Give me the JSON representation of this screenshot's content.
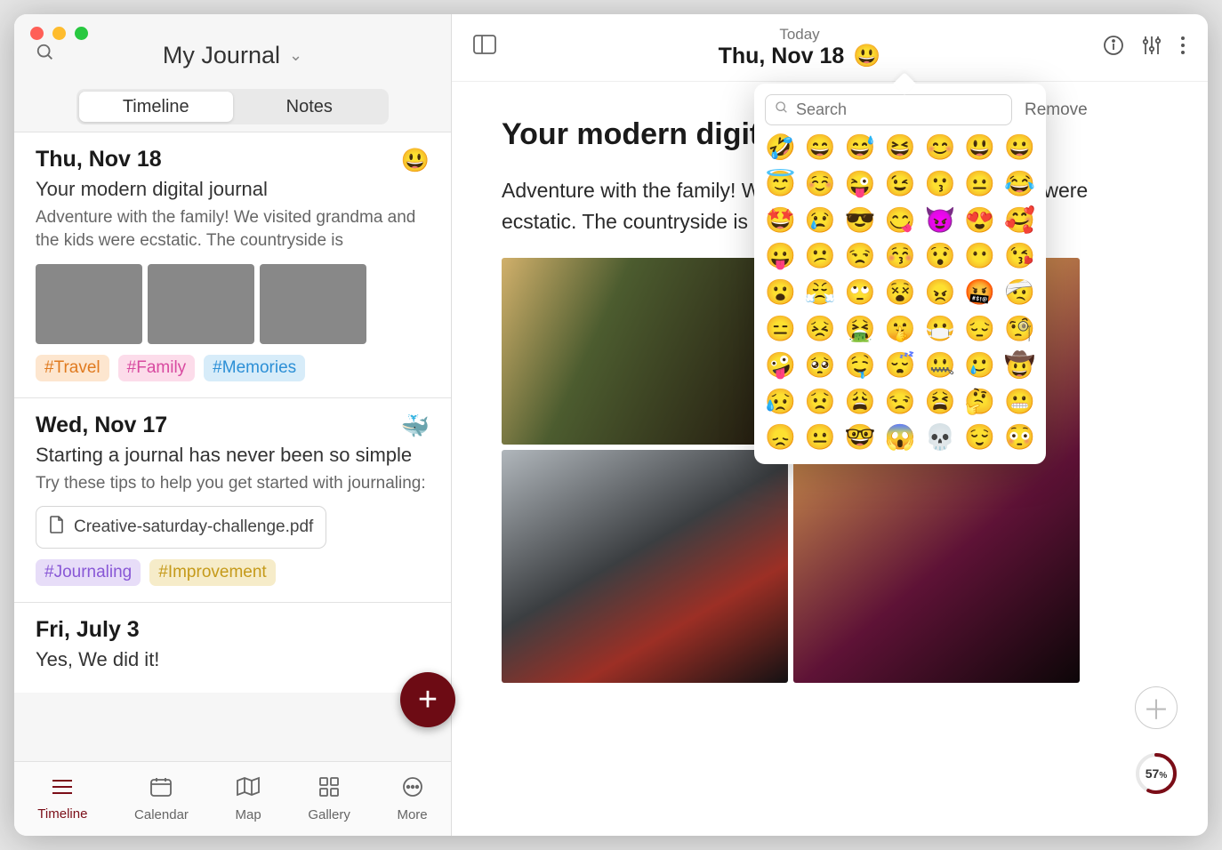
{
  "window": {
    "journal_name": "My Journal"
  },
  "traffic_light_colors": {
    "close": "#ff5f57",
    "minimize": "#febc2e",
    "zoom": "#28c840"
  },
  "segmented": {
    "timeline": "Timeline",
    "notes": "Notes",
    "active": "timeline"
  },
  "bottom_tabs": {
    "items": [
      {
        "icon": "timeline-icon",
        "label": "Timeline",
        "active": true
      },
      {
        "icon": "calendar-icon",
        "label": "Calendar",
        "active": false
      },
      {
        "icon": "map-icon",
        "label": "Map",
        "active": false
      },
      {
        "icon": "gallery-icon",
        "label": "Gallery",
        "active": false
      },
      {
        "icon": "more-icon",
        "label": "More",
        "active": false
      }
    ]
  },
  "entries": [
    {
      "date": "Thu, Nov 18",
      "emoji": "😃",
      "title": "Your modern digital journal",
      "body": "Adventure with the family! We visited grandma and the kids were ecstatic. The countryside is",
      "thumbs": 3,
      "tags": [
        {
          "text": "#Travel",
          "fg": "#e07a1f",
          "bg": "#fde6cf"
        },
        {
          "text": "#Family",
          "fg": "#d84aa0",
          "bg": "#fcdcea"
        },
        {
          "text": "#Memories",
          "fg": "#2c8fd6",
          "bg": "#d7ecf9"
        }
      ]
    },
    {
      "date": "Wed, Nov 17",
      "emoji": "🐳",
      "title": "Starting a journal has never been so simple",
      "body": "Try these tips to help you get started with journaling:",
      "attachment": "Creative-saturday-challenge.pdf",
      "tags": [
        {
          "text": "#Journaling",
          "fg": "#8857d6",
          "bg": "#e7ddf8"
        },
        {
          "text": "#Improvement",
          "fg": "#c59a1a",
          "bg": "#f6ecc9"
        }
      ]
    },
    {
      "date": "Fri, July 3",
      "title": "Yes, We did it!",
      "body": ""
    }
  ],
  "header": {
    "today_label": "Today",
    "date": "Thu, Nov 18",
    "mood_emoji": "😃"
  },
  "document": {
    "title": "Your modern digital journal",
    "body_visible": "Adventure with the family! We visited grandma and the kids were ecstatic. The countryside is"
  },
  "picker": {
    "search_placeholder": "Search",
    "remove_label": "Remove",
    "emojis": [
      "🤣",
      "😄",
      "😅",
      "😆",
      "😊",
      "😃",
      "😀",
      "😇",
      "☺️",
      "😜",
      "😉",
      "😗",
      "😐",
      "😂",
      "🤩",
      "😢",
      "😎",
      "😋",
      "😈",
      "😍",
      "🥰",
      "😛",
      "😕",
      "😒",
      "😚",
      "😯",
      "😶",
      "😘",
      "😮",
      "😤",
      "🙄",
      "😵",
      "😠",
      "🤬",
      "🤕",
      "😑",
      "😣",
      "🤮",
      "🤫",
      "😷",
      "😔",
      "🧐",
      "🤪",
      "🥺",
      "🤤",
      "😴",
      "🤐",
      "🥲",
      "🤠",
      "😥",
      "😟",
      "😩",
      "😒",
      "😫",
      "🤔",
      "😬",
      "😞",
      "😐",
      "🤓",
      "😱",
      "💀",
      "😌",
      "😳"
    ]
  },
  "progress": {
    "pct": 57,
    "suffix": "%"
  },
  "accent_color": "#6d0b14"
}
